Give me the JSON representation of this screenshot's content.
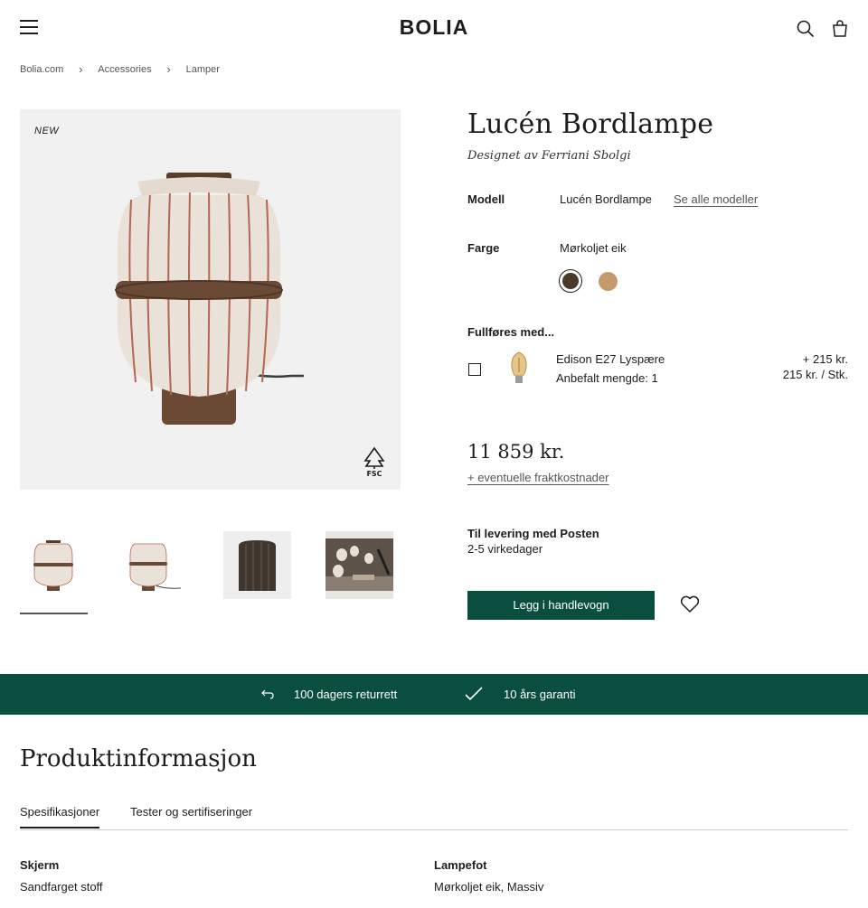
{
  "header": {
    "logo": "BOLIA",
    "menu_icon": "hamburger-menu-icon",
    "search_icon": "search-icon",
    "cart_icon": "shopping-bag-icon"
  },
  "breadcrumb": [
    "Bolia.com",
    "Accessories",
    "Lamper"
  ],
  "gallery": {
    "badge": "NEW",
    "fsc_logo_text": "FSC"
  },
  "product": {
    "title": "Lucén Bordlampe",
    "designer": "Designet av Ferriani Sbolgi",
    "model_label": "Modell",
    "model_value": "Lucén Bordlampe",
    "see_all_models": "Se alle modeller",
    "color_label": "Farge",
    "color_value": "Mørkoljet eik",
    "colors": [
      "#4a3a2c",
      "#c49a6c"
    ]
  },
  "addon": {
    "heading": "Fullføres med...",
    "name": "Edison E27 Lyspære",
    "recommended": "Anbefalt mengde: 1",
    "price_add": "+ 215 kr.",
    "unit_price": "215 kr. / Stk."
  },
  "pricing": {
    "price": "11 859 kr.",
    "shipping_link": "+ eventuelle fraktkostnader"
  },
  "delivery": {
    "title": "Til levering med Posten",
    "time": "2-5 virkedager"
  },
  "cta": {
    "add_to_cart": "Legg i handlevogn"
  },
  "usp": {
    "returns": "100 dagers returrett",
    "warranty": "10 års garanti",
    "accent": "#0a4e40"
  },
  "info": {
    "title": "Produktinformasjon",
    "tabs": [
      "Spesifikasjoner",
      "Tester og sertifiseringer"
    ],
    "specs": [
      {
        "label": "Skjerm",
        "value": "Sandfarget stoff"
      },
      {
        "label": "Lampefot",
        "value": "Mørkoljet eik, Massiv"
      }
    ]
  }
}
